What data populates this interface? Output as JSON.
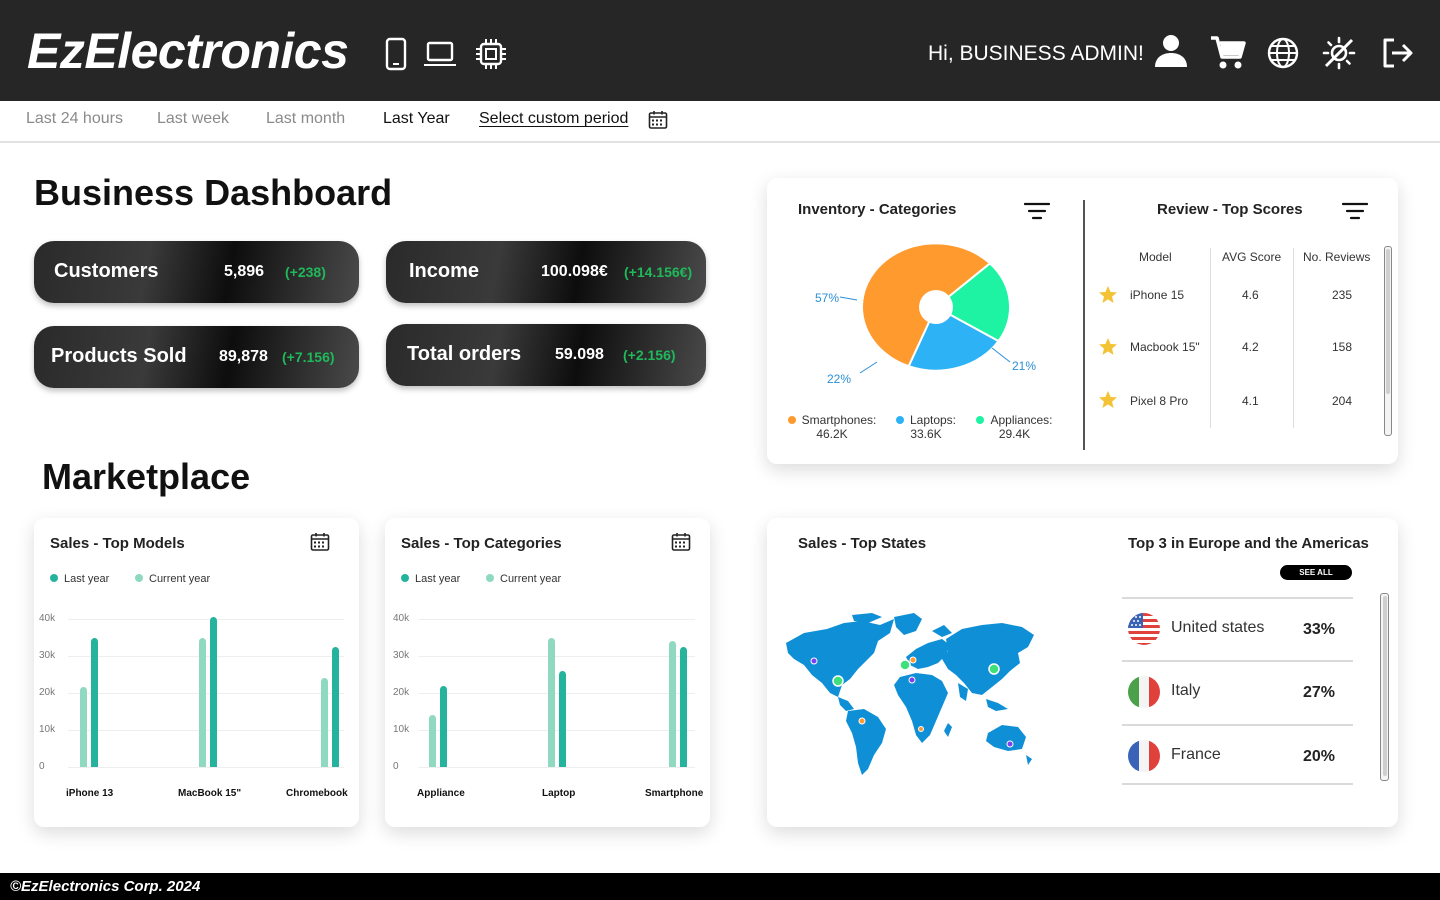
{
  "header": {
    "brand": "EzElectronics",
    "greeting": "Hi, BUSINESS ADMIN!",
    "category_icons": [
      "smartphone-icon",
      "laptop-icon",
      "chip-icon"
    ],
    "action_icons": [
      "user-icon",
      "cart-icon",
      "globe-icon",
      "theme-toggle-icon",
      "logout-icon"
    ]
  },
  "periods": {
    "items": [
      "Last 24 hours",
      "Last week",
      "Last month",
      "Last Year"
    ],
    "active": "Last Year",
    "custom": "Select custom period"
  },
  "dashboard": {
    "title": "Business Dashboard",
    "stats": [
      {
        "label": "Customers",
        "value": "5,896",
        "delta": "(+238)"
      },
      {
        "label": "Income",
        "value": "100.098€",
        "delta": "(+14.156€)"
      },
      {
        "label": "Products Sold",
        "value": "89,878",
        "delta": "(+7.156)"
      },
      {
        "label": "Total orders",
        "value": "59.098",
        "delta": "(+2.156)"
      }
    ]
  },
  "inventory": {
    "title": "Inventory - Categories",
    "slices": [
      {
        "label": "Smartphones:",
        "value": "46.2K",
        "percent": "57%",
        "share": 57,
        "color": "#ff9a2e"
      },
      {
        "label": "Laptops:",
        "value": "33.6K",
        "percent": "22%",
        "share": 22,
        "color": "#2db2f5"
      },
      {
        "label": "Appliances:",
        "value": "29.4K",
        "percent": "21%",
        "share": 21,
        "color": "#1df3a3"
      }
    ]
  },
  "reviews": {
    "title": "Review - Top Scores",
    "columns": [
      "Model",
      "AVG Score",
      "No. Reviews"
    ],
    "rows": [
      {
        "model": "iPhone 15",
        "score": "4.6",
        "reviews": "235"
      },
      {
        "model": "Macbook 15\"",
        "score": "4.2",
        "reviews": "158"
      },
      {
        "model": "Pixel 8 Pro",
        "score": "4.1",
        "reviews": "204"
      }
    ]
  },
  "marketplace": {
    "title": "Marketplace"
  },
  "sales_models": {
    "title": "Sales - Top Models",
    "legend": [
      "Last year",
      "Current year"
    ],
    "yticks": [
      "40k",
      "30k",
      "20k",
      "10k",
      "0"
    ]
  },
  "sales_categories": {
    "title": "Sales - Top Categories",
    "legend": [
      "Last year",
      "Current year"
    ],
    "yticks": [
      "40k",
      "30k",
      "20k",
      "10k",
      "0"
    ]
  },
  "chart_data": [
    {
      "type": "bar",
      "title": "Sales - Top Models",
      "categories": [
        "iPhone 13",
        "MacBook 15\"",
        "Chromebook"
      ],
      "series": [
        {
          "name": "Last year",
          "values": [
            21500,
            35000,
            24000
          ],
          "color": "#8fd9c0"
        },
        {
          "name": "Current year",
          "values": [
            35000,
            40500,
            32500
          ],
          "color": "#25b39e"
        }
      ],
      "ylim": [
        0,
        40000
      ],
      "grid": true,
      "legend": "top-left"
    },
    {
      "type": "bar",
      "title": "Sales - Top Categories",
      "categories": [
        "Appliance",
        "Laptop",
        "Smartphone"
      ],
      "series": [
        {
          "name": "Last year",
          "values": [
            14000,
            35000,
            34000
          ],
          "color": "#8fd9c0"
        },
        {
          "name": "Current year",
          "values": [
            22000,
            26000,
            32500
          ],
          "color": "#25b39e"
        }
      ],
      "ylim": [
        0,
        40000
      ],
      "grid": true,
      "legend": "top-left"
    }
  ],
  "states": {
    "title": "Sales - Top States",
    "top_title": "Top 3 in Europe and the Americas",
    "see_all": "SEE ALL",
    "countries": [
      {
        "name": "United states",
        "percent": "33%"
      },
      {
        "name": "Italy",
        "percent": "27%"
      },
      {
        "name": "France",
        "percent": "20%"
      }
    ]
  },
  "footer": {
    "text": "©EzElectronics Corp. 2024"
  }
}
